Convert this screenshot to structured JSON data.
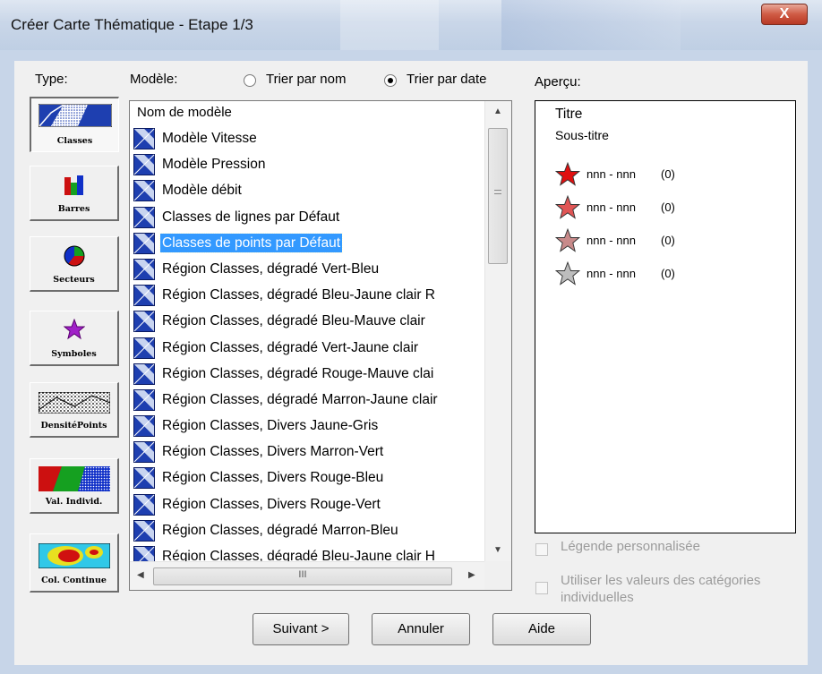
{
  "window": {
    "title": "Créer Carte Thématique - Etape 1/3",
    "close_glyph": "X"
  },
  "type_panel": {
    "label": "Type:",
    "buttons": [
      {
        "caption": "Classes",
        "icon": "classes-icon",
        "selected": true
      },
      {
        "caption": "Barres",
        "icon": "bars-chart-icon",
        "selected": false
      },
      {
        "caption": "Secteurs",
        "icon": "pie-chart-icon",
        "selected": false
      },
      {
        "caption": "Symboles",
        "icon": "star-symbol-icon",
        "selected": false
      },
      {
        "caption": "DensitéPoints",
        "icon": "dot-density-icon",
        "selected": false
      },
      {
        "caption": "Val. Individ.",
        "icon": "individual-values-icon",
        "selected": false
      },
      {
        "caption": "Col. Continue",
        "icon": "continuous-color-icon",
        "selected": false
      }
    ]
  },
  "model": {
    "label": "Modèle:",
    "sort_by_name": "Trier par nom",
    "sort_by_date": "Trier par date",
    "sort_selected": "date",
    "column_header": "Nom de modèle",
    "selected_index": 4,
    "items": [
      "Modèle Vitesse",
      "Modèle Pression",
      "Modèle débit",
      "Classes de lignes par Défaut",
      "Classes de points par Défaut",
      "Région Classes, dégradé Vert-Bleu",
      "Région Classes, dégradé Bleu-Jaune clair R",
      "Région Classes, dégradé Bleu-Mauve clair",
      "Région Classes, dégradé Vert-Jaune clair",
      "Région Classes, dégradé Rouge-Mauve clai",
      "Région Classes, dégradé Marron-Jaune clair",
      "Région Classes, Divers Jaune-Gris",
      "Région Classes, Divers Marron-Vert",
      "Région Classes, Divers Rouge-Bleu",
      "Région Classes, Divers Rouge-Vert",
      "Région Classes, dégradé Marron-Bleu",
      "Région Classes, dégradé Bleu-Jaune clair H"
    ],
    "hscroll_grip": "III"
  },
  "preview": {
    "label": "Aperçu:",
    "title": "Titre",
    "subtitle": "Sous-titre",
    "legend": [
      {
        "range": "nnn - nnn",
        "count": "(0)",
        "color": "#e01010"
      },
      {
        "range": "nnn - nnn",
        "count": "(0)",
        "color": "#e05555"
      },
      {
        "range": "nnn - nnn",
        "count": "(0)",
        "color": "#c88a8a"
      },
      {
        "range": "nnn - nnn",
        "count": "(0)",
        "color": "#bdbdbd"
      }
    ]
  },
  "options": {
    "custom_legend": "Légende personnalisée",
    "use_values_line1": "Utiliser les valeurs des catégories",
    "use_values_line2": "individuelles"
  },
  "buttons": {
    "next": "Suivant >",
    "cancel": "Annuler",
    "help": "Aide"
  }
}
